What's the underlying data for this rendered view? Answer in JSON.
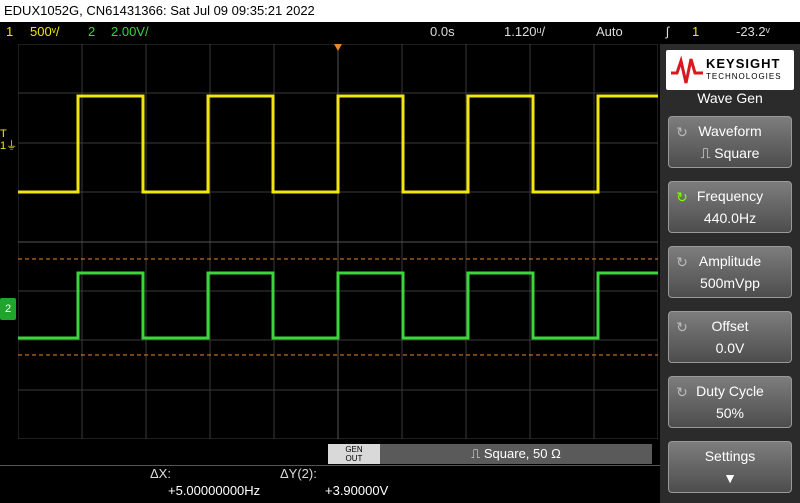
{
  "title": "EDUX1052G, CN61431366: Sat Jul 09 09:35:21 2022",
  "status": {
    "ch1_num": "1",
    "ch1_scale": "500ᵛ/",
    "ch2_num": "2",
    "ch2_scale": "2.00V/",
    "time_delay": "0.0s",
    "time_scale": "1.120ᵘ/",
    "trigger_mode": "Auto",
    "trigger_symbol": "ʃ",
    "trigger_channel": "1",
    "trigger_level": "-23.2ᵛ"
  },
  "markers": {
    "ch1": "1",
    "ch2": "2"
  },
  "panel": {
    "brand": "KEYSIGHT",
    "brand_sub": "TECHNOLOGIES",
    "title": "Wave Gen",
    "softkeys": [
      {
        "label": "Waveform",
        "value": "⎍ Square",
        "knob": false
      },
      {
        "label": "Frequency",
        "value": "440.0Hz",
        "knob": true
      },
      {
        "label": "Amplitude",
        "value": "500mVpp",
        "knob": false
      },
      {
        "label": "Offset",
        "value": "0.0V",
        "knob": false
      },
      {
        "label": "Duty Cycle",
        "value": "50%",
        "knob": false
      },
      {
        "label": "Settings",
        "value": "▼",
        "knob": false
      }
    ]
  },
  "gen": {
    "out_label_1": "GEN",
    "out_label_2": "OUT",
    "summary": "⎍ Square, 50 Ω"
  },
  "readouts": {
    "dx_label": "ΔX:",
    "dx_value": "+5.00000000Hz",
    "dy_label": "ΔY(2):",
    "dy_value": "+3.90000V"
  },
  "colors": {
    "ch1": "#f2e60c",
    "ch2": "#3ad63a",
    "cursor": "#e8872a"
  },
  "chart_data": {
    "type": "line",
    "series": [
      {
        "channel": "1",
        "waveform": "square",
        "periods_on_screen": 4.7,
        "duty": 0.5
      },
      {
        "channel": "2",
        "waveform": "square",
        "periods_on_screen": 4.7,
        "duty": 0.5
      }
    ]
  }
}
